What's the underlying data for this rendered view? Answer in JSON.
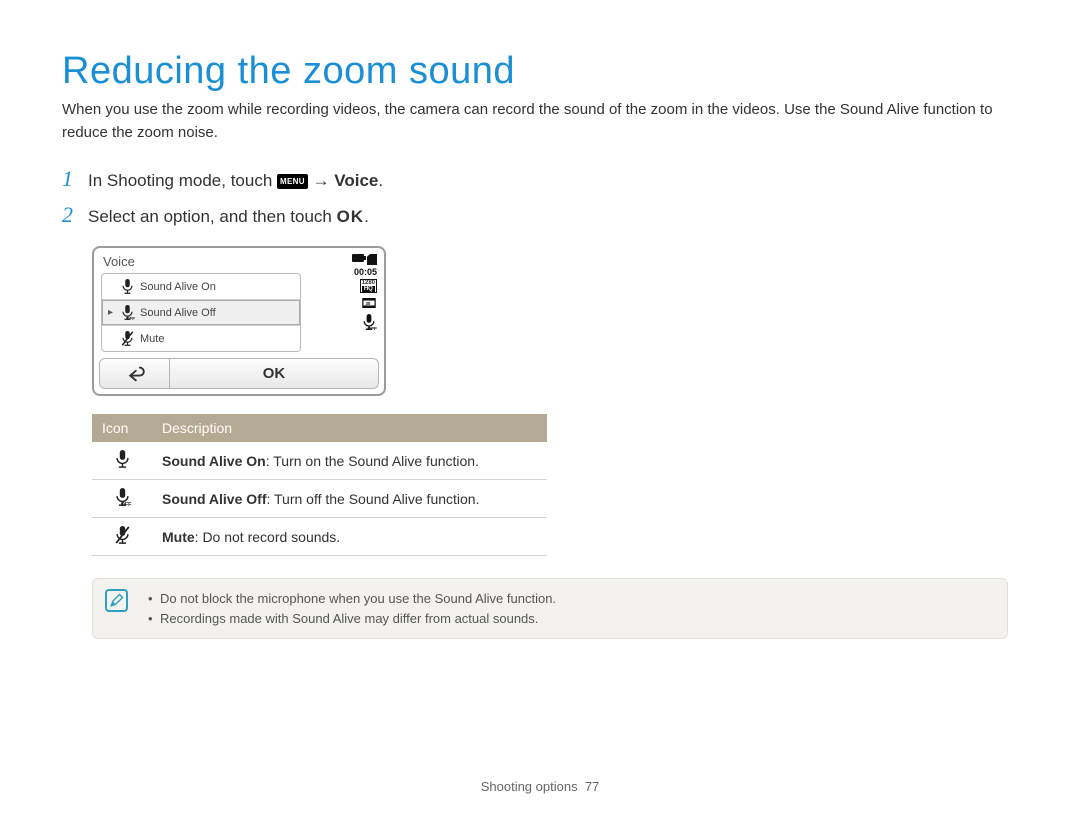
{
  "title": "Reducing the zoom sound",
  "intro": "When you use the zoom while recording videos, the camera can record the sound of the zoom in the videos. Use the Sound Alive function to reduce the zoom noise.",
  "steps": {
    "s1_pre": "In Shooting mode, touch ",
    "s1_arrow": " → ",
    "s1_bold": "Voice",
    "s1_suffix": ".",
    "s2_pre": "Select an option, and then touch ",
    "s2_ok": "OK",
    "s2_suffix": "."
  },
  "menu_badge": "MENU",
  "camera": {
    "title": "Voice",
    "timer": "00:05",
    "res_top": "1280",
    "res_bot": "HQ",
    "items": [
      {
        "label": "Sound Alive On"
      },
      {
        "label": "Sound Alive Off"
      },
      {
        "label": "Mute"
      }
    ],
    "ok": "OK"
  },
  "table": {
    "head_icon": "Icon",
    "head_desc": "Description",
    "rows": [
      {
        "bold": "Sound Alive On",
        "rest": ": Turn on the Sound Alive function."
      },
      {
        "bold": "Sound Alive Off",
        "rest": ": Turn off the Sound Alive function."
      },
      {
        "bold": "Mute",
        "rest": ": Do not record sounds."
      }
    ]
  },
  "notes": [
    "Do not block the microphone when you use the Sound Alive function.",
    "Recordings made with Sound Alive may differ from actual sounds."
  ],
  "footer_label": "Shooting options",
  "footer_page": "77"
}
